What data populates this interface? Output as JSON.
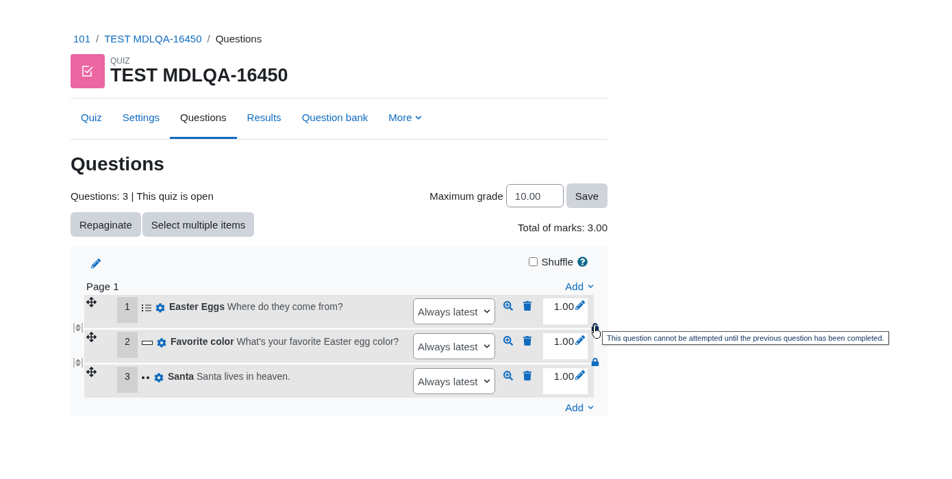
{
  "breadcrumb_separator": "/",
  "breadcrumb": [
    {
      "label": "101",
      "link": true
    },
    {
      "label": "TEST MDLQA-16450",
      "link": true
    },
    {
      "label": "Questions",
      "link": false
    }
  ],
  "header": {
    "kicker": "QUIZ",
    "title": "TEST MDLQA-16450"
  },
  "tabs": [
    {
      "label": "Quiz",
      "selected": false
    },
    {
      "label": "Settings",
      "selected": false
    },
    {
      "label": "Questions",
      "selected": true
    },
    {
      "label": "Results",
      "selected": false
    },
    {
      "label": "Question bank",
      "selected": false
    },
    {
      "label": "More",
      "selected": false,
      "dropdown": true
    }
  ],
  "heading": "Questions",
  "summary": "Questions: 3 | This quiz is open",
  "max_grade": {
    "label": "Maximum grade",
    "value": "10.00",
    "button": "Save"
  },
  "buttons": [
    "Repaginate",
    "Select multiple items"
  ],
  "total_marks": "Total of marks: 3.00",
  "section": {
    "shuffle": {
      "label": "Shuffle",
      "checked": false
    },
    "page_label": "Page 1",
    "add": "Add",
    "add_bottom": "Add",
    "questions": [
      {
        "number": "1",
        "kind": "multichoice",
        "name": "Easter Eggs",
        "text": "Where do they come from?",
        "version": "Always latest",
        "mark": "1.00"
      },
      {
        "number": "2",
        "kind": "shortanswer",
        "name": "Favorite color",
        "text": "What's your favorite Easter egg color?",
        "version": "Always latest",
        "mark": "1.00",
        "lock": {
          "locked": true,
          "hovered": true,
          "tooltip": "This question cannot be attempted until the previous question has been completed."
        }
      },
      {
        "number": "3",
        "kind": "truefalse",
        "name": "Santa",
        "text": "Santa lives in heaven.",
        "version": "Always latest",
        "mark": "1.00",
        "lock": {
          "locked": true,
          "hovered": false
        }
      }
    ]
  }
}
